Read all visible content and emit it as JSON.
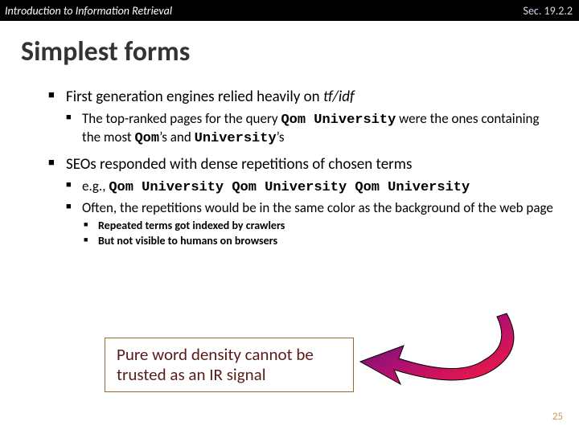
{
  "header": {
    "left": "Introduction to Information Retrieval",
    "right": "Sec. 19.2.2"
  },
  "title": "Simplest forms",
  "bullets": {
    "l1a_pre": "First generation engines relied heavily on ",
    "l1a_tfidf": "tf/idf",
    "l2a_pre": "The top-ranked pages for the query ",
    "l2a_q": "Qom University",
    "l2a_mid": " were the ones containing the most ",
    "l2a_q2": "Qom",
    "l2a_ap1": "’s and ",
    "l2a_q3": "University",
    "l2a_ap2": "’s",
    "l1b": "SEOs responded with dense repetitions of chosen terms",
    "l2b_pre": "e.g., ",
    "l2b_rep": "Qom University Qom University Qom University",
    "l2c": "Often, the repetitions would be in the same color as the background of the web page",
    "l3a": "Repeated terms got indexed by crawlers",
    "l3b": "But not visible to humans on browsers"
  },
  "callout": "Pure word density cannot be trusted as an IR signal",
  "page_number": "25"
}
